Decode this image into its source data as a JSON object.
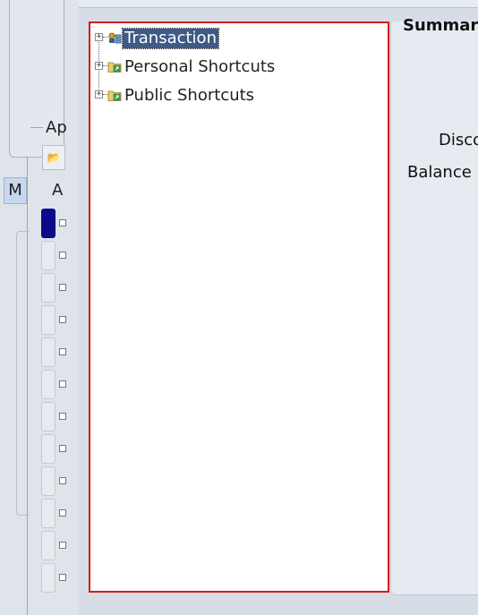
{
  "background": {
    "left_partial_labels": {
      "ap": "Ap",
      "m_tab": "M",
      "a": "A"
    },
    "right_partial_labels": {
      "summary": "Summary",
      "disco": "Disco",
      "balance": "Balance I"
    }
  },
  "tree": {
    "border_color": "#d21c1c",
    "selected_color": "#3e5a86",
    "nodes": [
      {
        "label": "Transaction",
        "icon": "transaction-icon",
        "expander": "+",
        "selected": true
      },
      {
        "label": "Personal Shortcuts",
        "icon": "folder-shortcut-icon",
        "expander": "+",
        "selected": false
      },
      {
        "label": "Public Shortcuts",
        "icon": "folder-shortcut-icon",
        "expander": "+",
        "selected": false
      }
    ]
  }
}
